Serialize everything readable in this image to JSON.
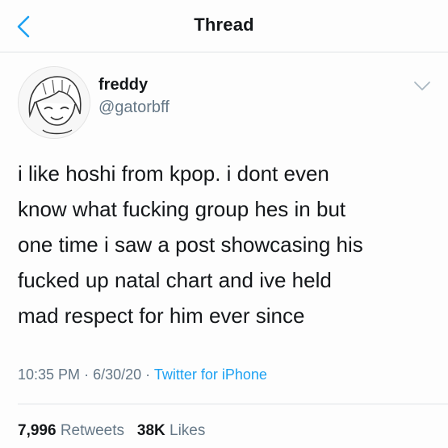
{
  "header": {
    "title": "Thread",
    "back_icon": "chevron-left-icon",
    "accent_color": "#1da1f2"
  },
  "tweet": {
    "display_name": "freddy",
    "handle": "@gatorbff",
    "text_lines": [
      "i like hoshi from kpop. i dont even",
      "know what fucking group hes in but",
      "one time i saw a post showcasing his",
      "fucked up natal chart and ive held",
      "mad respect for him ever since"
    ],
    "time": "10:35 PM",
    "date": "6/30/20",
    "separator": "·",
    "source": "Twitter for iPhone",
    "retweets_count": "7,996",
    "retweets_label": "Retweets",
    "likes_count": "38K",
    "likes_label": "Likes"
  }
}
